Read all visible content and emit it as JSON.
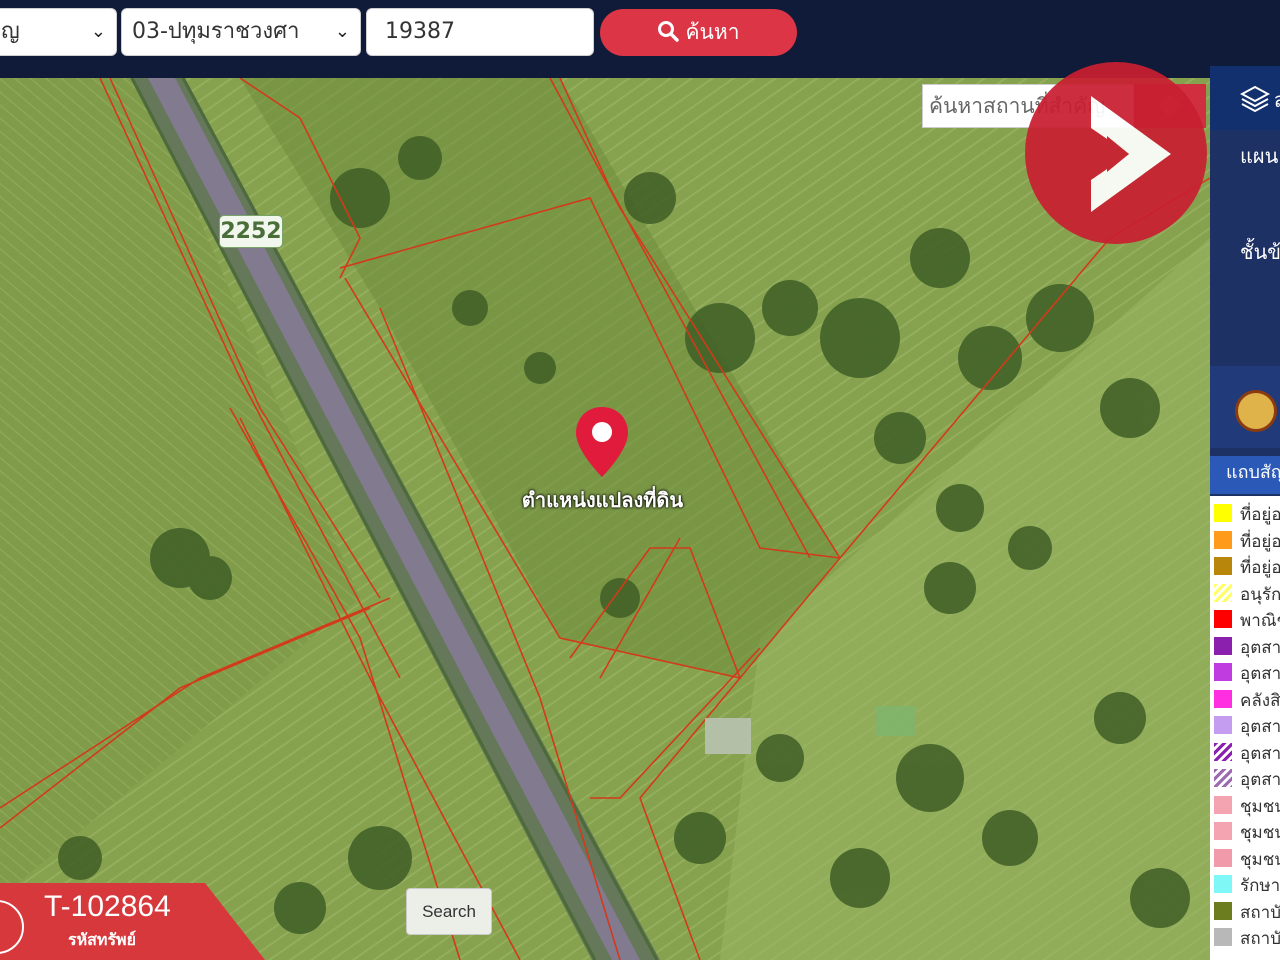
{
  "toolbar": {
    "province_value": "ญ",
    "district_value": "03-ปทุมราชวงศา",
    "parcel_number": "19387",
    "search_label": "ค้นหา"
  },
  "map": {
    "road_badge": "2252",
    "marker_label": "ตำแหน่งแปลงที่ดิน",
    "place_search_placeholder": "ค้นหาสถานที่สำคัญ",
    "search_button": "Search"
  },
  "sidebar": {
    "layers_label": "ส",
    "section1": "แผน",
    "section2": "ชั้นข้",
    "legend_title": "แถบสัญ",
    "legend": [
      {
        "label": "ที่อยู่อ",
        "color": "#ffff00",
        "pattern": "solid"
      },
      {
        "label": "ที่อยู่อ",
        "color": "#ff9a1a",
        "pattern": "solid"
      },
      {
        "label": "ที่อยู่อ",
        "color": "#b8860b",
        "pattern": "solid"
      },
      {
        "label": "อนุรัก",
        "color": "#ffff66",
        "pattern": "hatch"
      },
      {
        "label": "พาณิช",
        "color": "#ff0000",
        "pattern": "solid"
      },
      {
        "label": "อุตสา",
        "color": "#8b1fae",
        "pattern": "solid"
      },
      {
        "label": "อุตสา",
        "color": "#c03be0",
        "pattern": "solid"
      },
      {
        "label": "คลังสิ",
        "color": "#ff2ee0",
        "pattern": "solid"
      },
      {
        "label": "อุตสา",
        "color": "#c49cf0",
        "pattern": "solid"
      },
      {
        "label": "อุตสา",
        "color": "#8b1fae",
        "pattern": "hatch"
      },
      {
        "label": "อุตสา",
        "color": "#9b6ab0",
        "pattern": "hatch"
      },
      {
        "label": "ชุมชน",
        "color": "#f4a3b0",
        "pattern": "solid"
      },
      {
        "label": "ชุมชน",
        "color": "#f4a3b0",
        "pattern": "solid"
      },
      {
        "label": "ชุมชน",
        "color": "#f09aaa",
        "pattern": "solid"
      },
      {
        "label": "รักษา",
        "color": "#7ff7f7",
        "pattern": "solid"
      },
      {
        "label": "สถาบั",
        "color": "#6b7d1e",
        "pattern": "solid"
      },
      {
        "label": "สถาบั",
        "color": "#b8b8b8",
        "pattern": "solid"
      }
    ]
  },
  "listing": {
    "code": "T-102864",
    "code_label": "รหัสทรัพย์"
  },
  "colors": {
    "accent": "#dc3545",
    "topbar": "#0f1b38",
    "parcel_line": "#d23a1a",
    "marker": "#e01b3c"
  }
}
